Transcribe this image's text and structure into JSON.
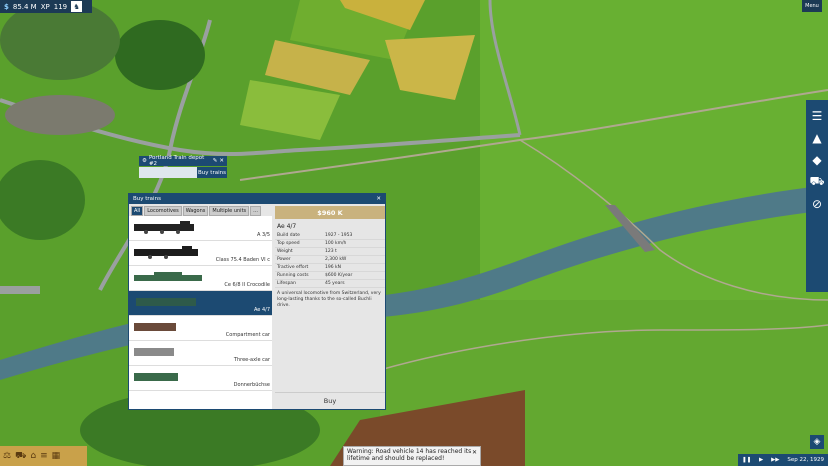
{
  "hud": {
    "money": "85.4 M",
    "xp_label": "XP",
    "xp_value": "119",
    "menu": "Menu"
  },
  "depot": {
    "name": "Portland Train depot #2",
    "buy_trains": "Buy trains"
  },
  "window": {
    "title": "Buy trains",
    "tabs": [
      "All",
      "Locomotives",
      "Wagons",
      "Multiple units",
      "..."
    ],
    "items": [
      {
        "label": "A 3/5"
      },
      {
        "label": "Class 75.4 Baden VI c"
      },
      {
        "label": "Ce 6/8 II Crocodile"
      },
      {
        "label": "Ae 4/7"
      },
      {
        "label": "Compartment car"
      },
      {
        "label": "Three-axle car"
      },
      {
        "label": "Donnerbüchse"
      }
    ],
    "selected_index": 3,
    "price": "$960 K",
    "vehicle_name": "Ae 4/7",
    "stats": [
      {
        "key": "Build date",
        "value": "1927 - 1953"
      },
      {
        "key": "Top speed",
        "value": "100 km/h"
      },
      {
        "key": "Weight",
        "value": "123 t"
      },
      {
        "key": "Power",
        "value": "2,300 kW"
      },
      {
        "key": "Tractive effort",
        "value": "196 kN"
      },
      {
        "key": "Running costs",
        "value": "$600 K/year"
      },
      {
        "key": "Lifespan",
        "value": "45 years"
      }
    ],
    "description": "A universal locomotive from Switzerland, very long-lasting thanks to the so-called Buchli drive.",
    "buy_button": "Buy"
  },
  "notification": {
    "text": "Warning: Road vehicle 14 has reached its lifetime and should be replaced!"
  },
  "clock": {
    "date": "Sep 22, 1929"
  },
  "colors": {
    "ui_blue": "#1c4a72",
    "price_bar": "#c9b27e",
    "grass": "#5a9a2a"
  }
}
